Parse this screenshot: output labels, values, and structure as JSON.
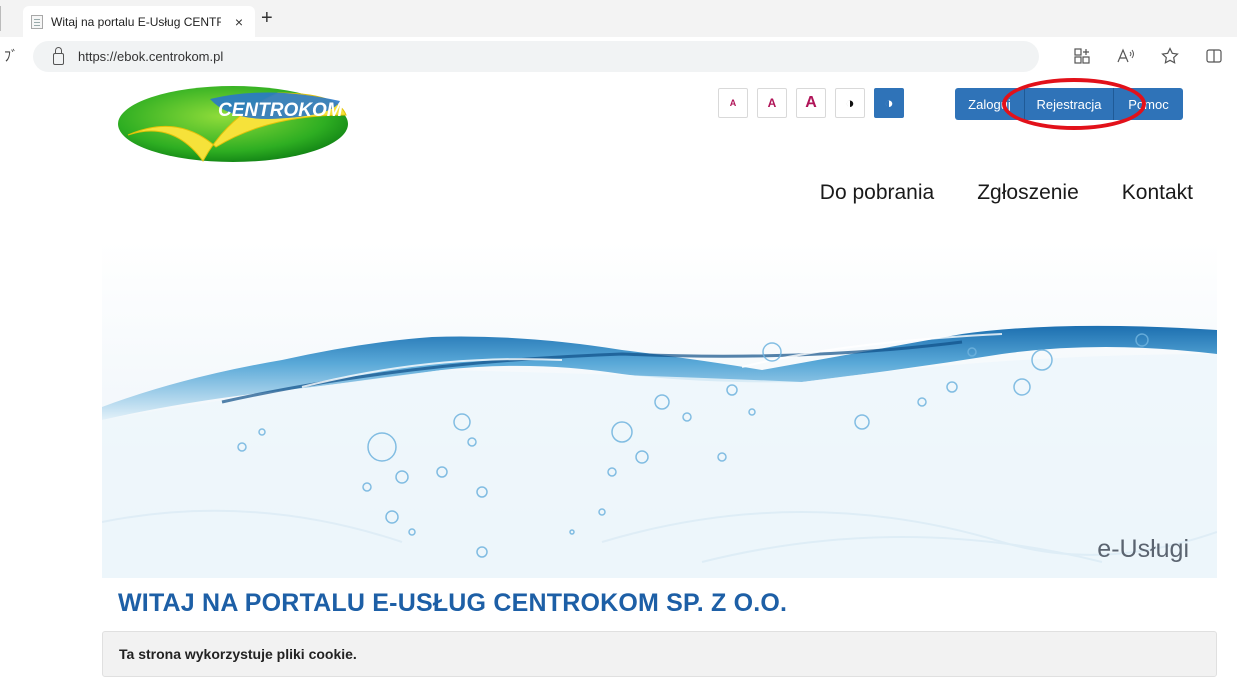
{
  "browser": {
    "tab_title": "Witaj na portalu E-Usług CENTRO",
    "tab_close": "×",
    "new_tab": "+",
    "url": "https://ebok.centrokom.pl",
    "back_glyph": "ﾌﾞ"
  },
  "logo": {
    "text": "CENTROKOM"
  },
  "accessibility": {
    "font_small": "A",
    "font_medium": "A",
    "font_large": "A",
    "contrast": "◑",
    "contrast_alt": "◑"
  },
  "auth": {
    "login": "Zaloguj",
    "register": "Rejestracja",
    "help": "Pomoc"
  },
  "nav": {
    "items": [
      "Do pobrania",
      "Zgłoszenie",
      "Kontakt"
    ]
  },
  "hero": {
    "caption": "e-Usługi"
  },
  "main": {
    "welcome": "WITAJ NA PORTALU E-USŁUG CENTROKOM SP. Z O.O.",
    "cookie_notice": "Ta strona wykorzystuje pliki cookie."
  },
  "colors": {
    "primary_blue": "#2f73b8",
    "accent_magenta": "#b01458",
    "heading_blue": "#1d5fa6",
    "annotation_red": "#e2111a"
  }
}
